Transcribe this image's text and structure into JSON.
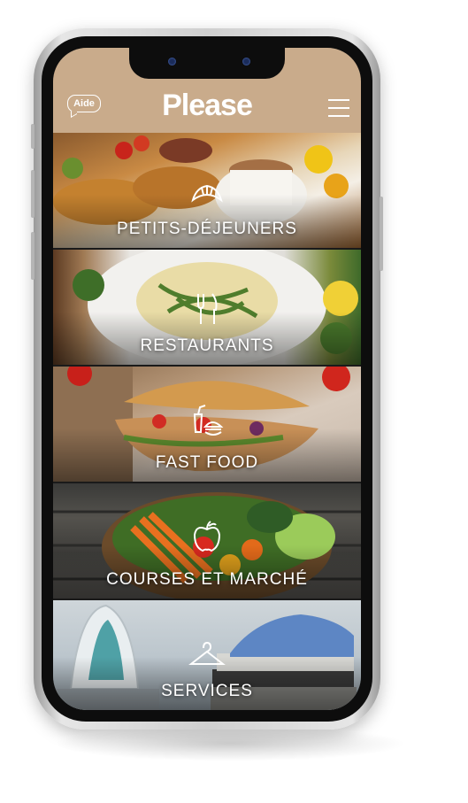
{
  "header": {
    "help_label": "Aide",
    "logo": "Please"
  },
  "categories": [
    {
      "label": "PETITS-DÉJEUNERS",
      "icon": "croissant-icon"
    },
    {
      "label": "RESTAURANTS",
      "icon": "fork-knife-icon"
    },
    {
      "label": "FAST FOOD",
      "icon": "burger-drink-icon"
    },
    {
      "label": "COURSES ET MARCHÉ",
      "icon": "apple-icon"
    },
    {
      "label": "SERVICES",
      "icon": "hanger-icon"
    }
  ],
  "colors": {
    "header_bg": "#c9ab8b",
    "text": "#ffffff"
  }
}
